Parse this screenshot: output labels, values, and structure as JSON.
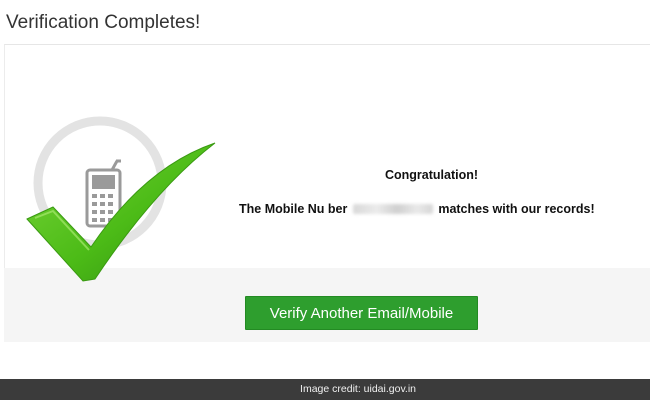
{
  "page": {
    "title": "Verification Completes!"
  },
  "result": {
    "heading": "Congratulation!",
    "message_prefix": "The Mobile Nu",
    "message_mid": "ber",
    "message_suffix": "matches with our records!",
    "icons": [
      "mobile-phone-icon",
      "checkmark-icon"
    ]
  },
  "actions": {
    "verify_another_label": "Verify Another Email/Mobile"
  },
  "footer": {
    "credit": "Image credit: uidai.gov.in"
  },
  "colors": {
    "button_green": "#2e9e2e",
    "check_green": "#4cbb17",
    "footer_bg": "#3b3b3b"
  }
}
